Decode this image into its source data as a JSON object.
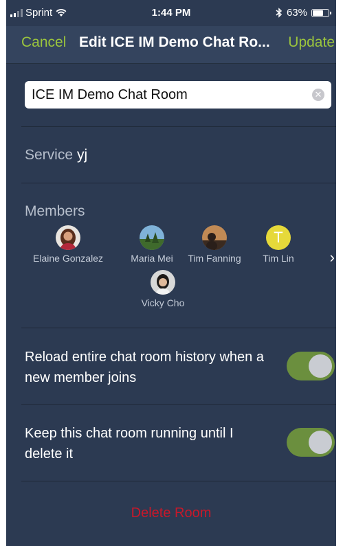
{
  "status_bar": {
    "carrier": "Sprint",
    "time": "1:44 PM",
    "battery_percent": "63%",
    "battery_level": 0.63
  },
  "nav": {
    "cancel_label": "Cancel",
    "title": "Edit ICE IM Demo Chat Ro...",
    "update_label": "Update"
  },
  "room": {
    "name_value": "ICE IM Demo Chat Room",
    "clear_glyph": "✕"
  },
  "service": {
    "label": "Service",
    "value": "yj"
  },
  "members": {
    "label": "Members",
    "items": [
      {
        "name": "Elaine Gonzalez"
      },
      {
        "name": "Maria Mei"
      },
      {
        "name": "Tim Fanning"
      },
      {
        "name": "Tim Lin",
        "initial": "T"
      },
      {
        "name": "Vicky Cho"
      }
    ]
  },
  "settings": {
    "reload_label": "Reload entire chat room history when a new member joins",
    "reload_on": true,
    "keep_label": "Keep this chat room running until I delete it",
    "keep_on": true
  },
  "actions": {
    "delete_label": "Delete Room"
  },
  "colors": {
    "accent": "#9bc53d",
    "background": "#2c3a52",
    "nav_background": "#34445e",
    "danger": "#c8182a",
    "toggle_on": "#6b8f3e",
    "avatar_initial_bg": "#e6d93a"
  }
}
